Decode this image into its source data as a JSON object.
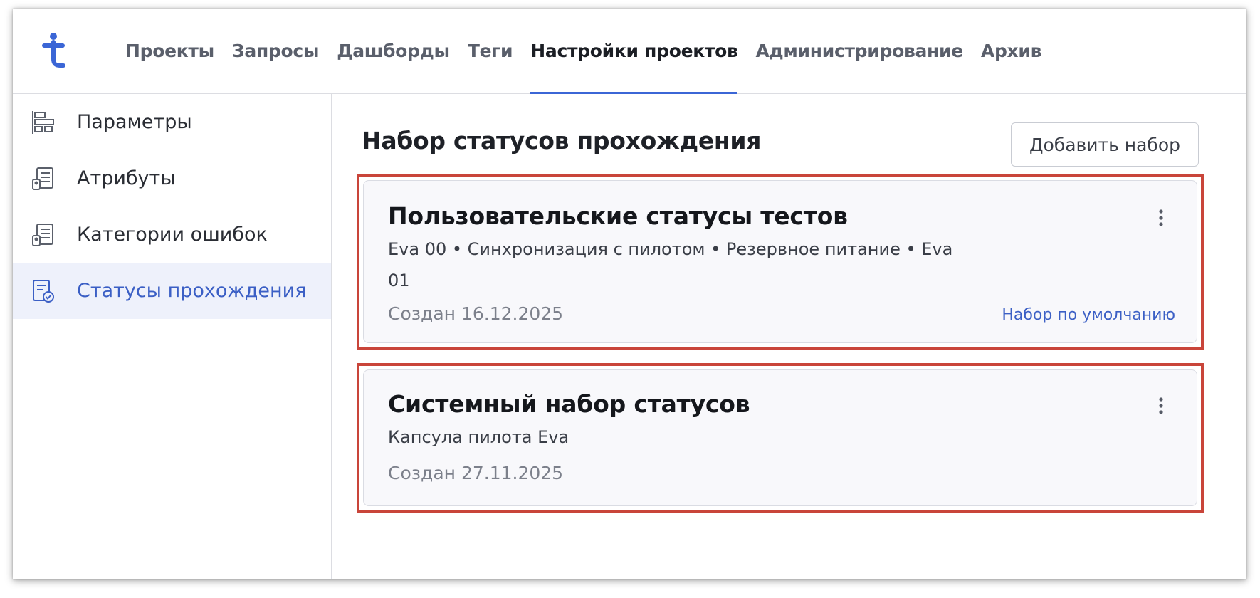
{
  "nav": {
    "logo_icon": "t-logo-icon",
    "items": [
      {
        "label": "Проекты",
        "active": false
      },
      {
        "label": "Запросы",
        "active": false
      },
      {
        "label": "Дашборды",
        "active": false
      },
      {
        "label": "Теги",
        "active": false
      },
      {
        "label": "Настройки проектов",
        "active": true
      },
      {
        "label": "Администрирование",
        "active": false
      },
      {
        "label": "Архив",
        "active": false
      }
    ]
  },
  "sidebar": {
    "items": [
      {
        "label": "Параметры",
        "icon": "parameters-icon",
        "active": false
      },
      {
        "label": "Атрибуты",
        "icon": "attributes-icon",
        "active": false
      },
      {
        "label": "Категории ошибок",
        "icon": "error-categories-icon",
        "active": false
      },
      {
        "label": "Статусы прохождения",
        "icon": "pass-statuses-icon",
        "active": true
      }
    ]
  },
  "main": {
    "title": "Набор статусов прохождения",
    "add_button_label": "Добавить набор",
    "cards": [
      {
        "title": "Пользовательские статусы тестов",
        "description": "Eva 00 • Синхронизация с пилотом • Резервное питание • Eva 01",
        "created": "Создан 16.12.2025",
        "default_label": "Набор по умолчанию"
      },
      {
        "title": "Системный набор статусов",
        "description": "Капсула пилота Eva",
        "created": "Создан 27.11.2025"
      }
    ]
  },
  "colors": {
    "accent": "#3b66d6",
    "highlight_border": "#c9453a",
    "active_sidebar_bg": "#eef1fb"
  }
}
